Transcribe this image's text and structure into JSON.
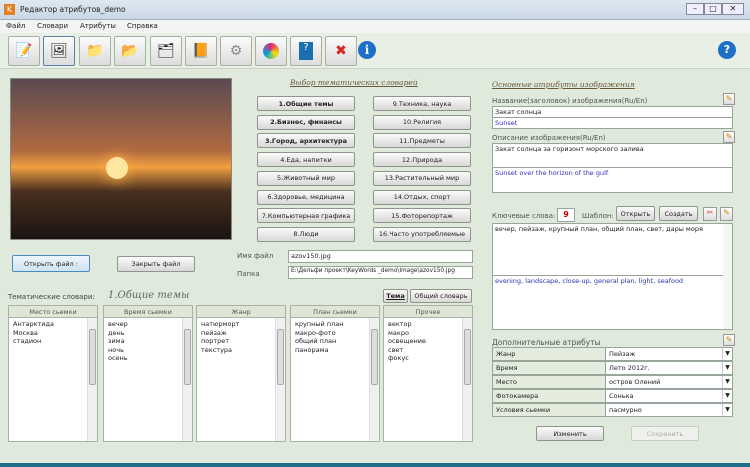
{
  "window": {
    "title": "Редактор атрибутов_demo",
    "app_icon": "K"
  },
  "menu": [
    "Файл",
    "Словари",
    "Атрибуты",
    "Справка"
  ],
  "toolbar": {
    "icons": [
      "edit-notebook-icon",
      "open-image-icon",
      "folder-image-icon",
      "folder-image-2-icon",
      "folder-dark-icon",
      "book-copy-icon",
      "settings-icon",
      "color-icon",
      "help-book-icon",
      "close-x-icon",
      "info-icon"
    ],
    "help": "?"
  },
  "left": {
    "open_file": "Открыть файл :",
    "close_file": "Закрыть файл"
  },
  "dict": {
    "title": "Выбор тематических словарей",
    "buttons": [
      "1.Общие темы",
      "2.Бизнес, финансы",
      "3.Город, архитектура",
      "4.Еда, напитки",
      "5.Животный мир",
      "6.Здоровье, медицина",
      "7.Компьютерная графика",
      "8.Люди",
      "9.Техника, наука",
      "10.Религия",
      "11.Предметы",
      "12.Природа",
      "13.Растительный мир",
      "14.Отдых, спорт",
      "15.Фоторепортаж",
      "16.Часто употребляемые"
    ]
  },
  "file": {
    "name_label": "Имя файл",
    "name": "azov150.jpg",
    "folder_label": "Папка",
    "folder": "E:\\Дельфи проект\\KeyWords _demo\\Image\\azov150.jpg"
  },
  "thematic": {
    "label": "Тематические словари:",
    "current": "1.Общие темы",
    "tab_theme": "Тема",
    "tab_general": "Общий словарь",
    "lists": [
      {
        "header": "Место сьемки",
        "items": [
          "Антарктида",
          "Москва",
          "стадион"
        ]
      },
      {
        "header": "Время сьемки",
        "items": [
          "вечер",
          "день",
          "зима",
          "ночь",
          "осень"
        ]
      },
      {
        "header": "Жанр",
        "items": [
          "натюрморт",
          "пейзаж",
          "портрет",
          "текстура"
        ]
      },
      {
        "header": "План сьемки",
        "items": [
          "крупный план",
          "макро-фото",
          "общий план",
          "панорама"
        ]
      },
      {
        "header": "Прочее",
        "items": [
          "вектор",
          "макро",
          "освещение",
          "свет",
          "фокус"
        ]
      }
    ]
  },
  "attrs": {
    "title": "Основные атрибуты изображения",
    "name_label": "Название(заголовок) изображения(Ru/En)",
    "name_ru": "Закат солнца",
    "name_en": "Sunset",
    "desc_label": "Описание  изображения(Ru/En)",
    "desc_ru": "Закат солнца за горизонт морского залива",
    "desc_en": "Sunset over the horizon of the gulf",
    "kw_label": "Ключевые слова:",
    "kw_count": "9",
    "template_label": "Шаблон:",
    "open": "Открыть",
    "create": "Создать",
    "kw_ru": "вечер, пейзаж, крупный план, общий план, свет, дары моря",
    "kw_en": "evening, landscape, close-up, general plan, light, seafood"
  },
  "extra": {
    "title": "Дополнительные атрибуты",
    "rows": [
      {
        "k": "Жанр",
        "v": "Пейзаж"
      },
      {
        "k": "Время",
        "v": "Лето 2012г."
      },
      {
        "k": "Место",
        "v": "остров Олений"
      },
      {
        "k": "Фотокамера",
        "v": "Сонька"
      },
      {
        "k": "Условия сьемки",
        "v": "пасмурно"
      }
    ]
  },
  "actions": {
    "change": "Изменить",
    "save": "Сохранить"
  }
}
